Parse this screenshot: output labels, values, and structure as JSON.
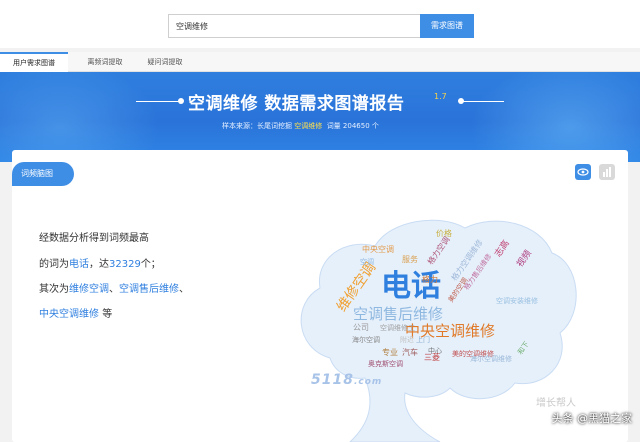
{
  "search": {
    "value": "空调维修",
    "button_label": "需求图谱"
  },
  "tabs": [
    {
      "label": "用户需求图谱",
      "active": true
    },
    {
      "label": "离频词提取",
      "active": false
    },
    {
      "label": "疑问词提取",
      "active": false
    }
  ],
  "banner": {
    "title": "空调维修 数据需求图谱报告",
    "version": "1.7",
    "sample_prefix": "样本来源：",
    "sample_source": "长尾词挖掘",
    "sample_keyword": "空调维修",
    "volume_label": "词量",
    "volume_value": "204650",
    "volume_unit": "个"
  },
  "card": {
    "tag": "词频脑图"
  },
  "summary": {
    "line1": "经数据分析得到词频最高",
    "line2_prefix": "的词为",
    "line2_word": "电话",
    "line2_mid": "，达",
    "line2_count": "32329",
    "line2_suffix": "个；",
    "line3_prefix": "其次为",
    "line3_word1": "维修空调",
    "line3_sep1": "、",
    "line3_word2": "空调售后维修",
    "line3_sep2": "、",
    "line4_word": "中央空调维修",
    "line4_suffix": "等"
  },
  "wordcloud": {
    "words": [
      {
        "text": "电话",
        "color": "#2f7fdf"
      },
      {
        "text": "维修空调",
        "color": "#f0a030"
      },
      {
        "text": "空调售后维修",
        "color": "#8fb8e0"
      },
      {
        "text": "中央空调维修",
        "color": "#e07a28"
      },
      {
        "text": "中央空调",
        "color": "#e39a4a"
      },
      {
        "text": "服务",
        "color": "#d9a050"
      },
      {
        "text": "价格",
        "color": "#c8b040"
      },
      {
        "text": "格力空调",
        "color": "#b05a7a"
      },
      {
        "text": "格力空调维修",
        "color": "#9fb8d8"
      },
      {
        "text": "志高",
        "color": "#c04070"
      },
      {
        "text": "视频",
        "color": "#b04080"
      },
      {
        "text": "格力",
        "color": "#d27a3a"
      },
      {
        "text": "空调安装维修",
        "color": "#9ac0e0"
      },
      {
        "text": "公司",
        "color": "#999999"
      },
      {
        "text": "空调维修工",
        "color": "#a0a0a0"
      },
      {
        "text": "海尔空调",
        "color": "#888888"
      },
      {
        "text": "附近",
        "color": "#c0c0c0"
      },
      {
        "text": "上门",
        "color": "#8fb0d0"
      },
      {
        "text": "中心",
        "color": "#777777"
      },
      {
        "text": "美的空调维修",
        "color": "#c05050"
      },
      {
        "text": "专业",
        "color": "#b08040"
      },
      {
        "text": "汽车",
        "color": "#a06060"
      },
      {
        "text": "三菱",
        "color": "#c04040"
      },
      {
        "text": "奥克斯空调",
        "color": "#a05070"
      },
      {
        "text": "海尔空调维修",
        "color": "#9ab8d8"
      },
      {
        "text": "和下",
        "color": "#70b070"
      },
      {
        "text": "美的空调",
        "color": "#c06050"
      },
      {
        "text": "格力售后维修",
        "color": "#c070a0"
      },
      {
        "text": "空调",
        "color": "#8fb8e0"
      }
    ]
  },
  "watermark": {
    "site": "5118",
    "domain": ".com"
  },
  "source_mark": "头条 @黑猫之家",
  "ghost_text": "增长帮人"
}
